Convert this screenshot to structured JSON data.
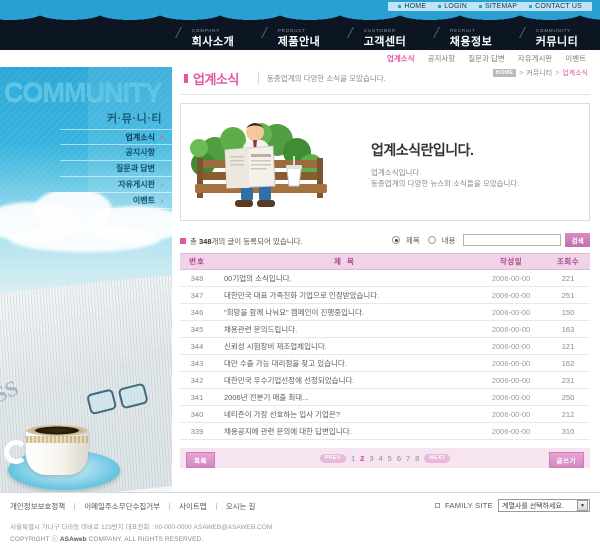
{
  "colors": {
    "accent_pink": "#e456a5",
    "nav_blue": "#2a9fd4",
    "nav_dark": "#0c1622",
    "table_header_bg": "#f0d3e6",
    "pager_bg": "#f7e4f1"
  },
  "topbar": {
    "links": [
      {
        "label": "HOME"
      },
      {
        "label": "LOGIN"
      },
      {
        "label": "SITEMAP"
      },
      {
        "label": "CONTACT US"
      }
    ]
  },
  "mainnav": {
    "items": [
      {
        "eng": "COMPANY",
        "kor": "회사소개",
        "active": false
      },
      {
        "eng": "PRODUCT",
        "kor": "제품안내",
        "active": false
      },
      {
        "eng": "CUSTOMER",
        "kor": "고객센터",
        "active": false
      },
      {
        "eng": "RECRUIT",
        "kor": "채용정보",
        "active": false
      },
      {
        "eng": "COMMUNITY",
        "kor": "커뮤니티",
        "active": true
      }
    ]
  },
  "subnav": {
    "items": [
      {
        "label": "업계소식",
        "active": true
      },
      {
        "label": "공지사항",
        "active": false
      },
      {
        "label": "질문과 답변",
        "active": false
      },
      {
        "label": "자유게시판",
        "active": false
      },
      {
        "label": "이벤트",
        "active": false
      }
    ]
  },
  "sidebar": {
    "title": "COMMUNITY",
    "subtitle": "커·뮤·니·티",
    "items": [
      {
        "label": "업계소식",
        "active": true
      },
      {
        "label": "공지사항",
        "active": false
      },
      {
        "label": "질문과 답변",
        "active": false
      },
      {
        "label": "자유게시판",
        "active": false
      },
      {
        "label": "이벤트",
        "active": false
      }
    ],
    "photo_headline": "SS"
  },
  "page": {
    "title": "업계소식",
    "description": "동종업계의 다양한 소식을 모았습니다.",
    "breadcrumb": {
      "home": "HOME",
      "sep1": ">",
      "level1": "커뮤니티",
      "sep2": ">",
      "level2": "업계소식"
    }
  },
  "banner": {
    "title": "업계소식란입니다.",
    "line1": "업계소식입니다.",
    "line2": "동종업계의 다양한 뉴스와 소식들을 모았습니다.",
    "art_alt": "man-reading-newspaper-on-bench"
  },
  "search": {
    "count_prefix": "총 ",
    "count_value": "348",
    "count_suffix": "개의 글이 등록되어 있습니다.",
    "radio_title": "제목",
    "radio_content": "내용",
    "input_value": "",
    "input_placeholder": "",
    "button_label": "검색"
  },
  "table": {
    "headers": {
      "no": "번호",
      "title": "제  목",
      "date": "작성일",
      "hits": "조회수"
    },
    "rows": [
      {
        "no": "348",
        "title": "00기업의 소식입니다.",
        "date": "2006-00-00",
        "hits": "221"
      },
      {
        "no": "347",
        "title": "대한민국 대표 가족친화 기업으로 인정받았습니다.",
        "date": "2006-00-00",
        "hits": "251"
      },
      {
        "no": "346",
        "title": "\"희망을 함께 나눠요\" 캠페인이 진행중입니다.",
        "date": "2006-00-00",
        "hits": "150"
      },
      {
        "no": "345",
        "title": "채용관련 문의드립니다.",
        "date": "2006-00-00",
        "hits": "163"
      },
      {
        "no": "344",
        "title": "신뢰성 시험장비 제조업체입니다.",
        "date": "2006-00-00",
        "hits": "121"
      },
      {
        "no": "343",
        "title": "대만 수출 가능 대리점을 찾고 있습니다.",
        "date": "2006-00-00",
        "hits": "162"
      },
      {
        "no": "342",
        "title": "대한민국 우수기업선정에 선정되었습니다.",
        "date": "2006-00-00",
        "hits": "231"
      },
      {
        "no": "341",
        "title": "2006년 전분기 매출 최대...",
        "date": "2006-00-00",
        "hits": "250"
      },
      {
        "no": "340",
        "title": "네티즌이 가장 선호하는 입사 기업은?",
        "date": "2006-00-00",
        "hits": "212"
      },
      {
        "no": "339",
        "title": "채용공지에 관련 문의에 대한 답변입니다.",
        "date": "2006-00-00",
        "hits": "310"
      }
    ]
  },
  "pager": {
    "list_label": "목록",
    "write_label": "글쓰기",
    "prev_label": "PREV",
    "next_label": "NEXT",
    "pages": [
      {
        "n": "1",
        "active": false
      },
      {
        "n": "2",
        "active": true
      },
      {
        "n": "3",
        "active": false
      },
      {
        "n": "4",
        "active": false
      },
      {
        "n": "5",
        "active": false
      },
      {
        "n": "6",
        "active": false
      },
      {
        "n": "7",
        "active": false
      },
      {
        "n": "8",
        "active": false
      }
    ]
  },
  "footer": {
    "links": [
      {
        "label": "개인정보보호정책"
      },
      {
        "label": "이메일주소무단수집거부"
      },
      {
        "label": "사이트맵"
      },
      {
        "label": "오시는 길"
      }
    ],
    "family_label": "FAMILY SITE",
    "family_selected": "계열사를 선택하세요.",
    "address": "서울특별시 가나구 다라동 마바로 123번지   대표전화 : 00-000-0000   ASAWEB@ASAWEB.COM",
    "copyright_pre": "COPYRIGHT ⓒ ",
    "copyright_brand": "ASAweb",
    "copyright_post": " COMPANY, ALL RIGHTS RESERVED."
  }
}
